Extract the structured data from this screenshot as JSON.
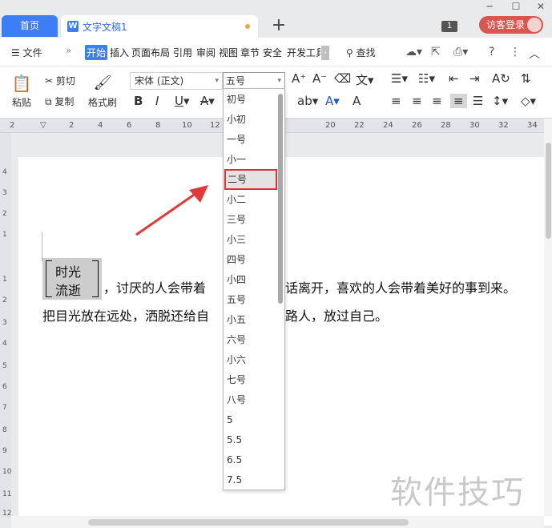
{
  "titlebar": {
    "home_tab": "首页",
    "doc_tab": "文字文稿1",
    "doc_icon": "W",
    "new_tab": "+",
    "window_badge": "1",
    "login": "访客登录"
  },
  "ribbon": {
    "file_menu": "文件",
    "tabs": [
      "开始",
      "插入",
      "页面布局",
      "引用",
      "审阅",
      "视图",
      "章节",
      "安全",
      "开发工具"
    ],
    "search": "查找",
    "paste": "粘贴",
    "cut": "剪切",
    "copy": "复制",
    "format_painter": "格式刷",
    "font_name": "宋体 (正文)",
    "font_size": "五号"
  },
  "font_size_dropdown": {
    "items": [
      "初号",
      "小初",
      "一号",
      "小一",
      "二号",
      "小二",
      "三号",
      "小三",
      "四号",
      "小四",
      "五号",
      "小五",
      "六号",
      "小六",
      "七号",
      "八号",
      "5",
      "5.5",
      "6.5",
      "7.5"
    ],
    "selected": "二号"
  },
  "document": {
    "combined_line1": "时光",
    "combined_line2": "流逝",
    "line1_rest": "，讨厌的人会带着 ",
    "line1_tail": "话离开，喜欢的人会带着美好的事到来。",
    "line2_head": "把目光放在远处，洒脱还给自",
    "line2_tail": "路人，放过自己。"
  },
  "watermark": "软件技巧",
  "colors": {
    "accent": "#3d7df5",
    "login": "#d95550",
    "highlight_box": "#d9323a",
    "arrow": "#e03a3a"
  }
}
